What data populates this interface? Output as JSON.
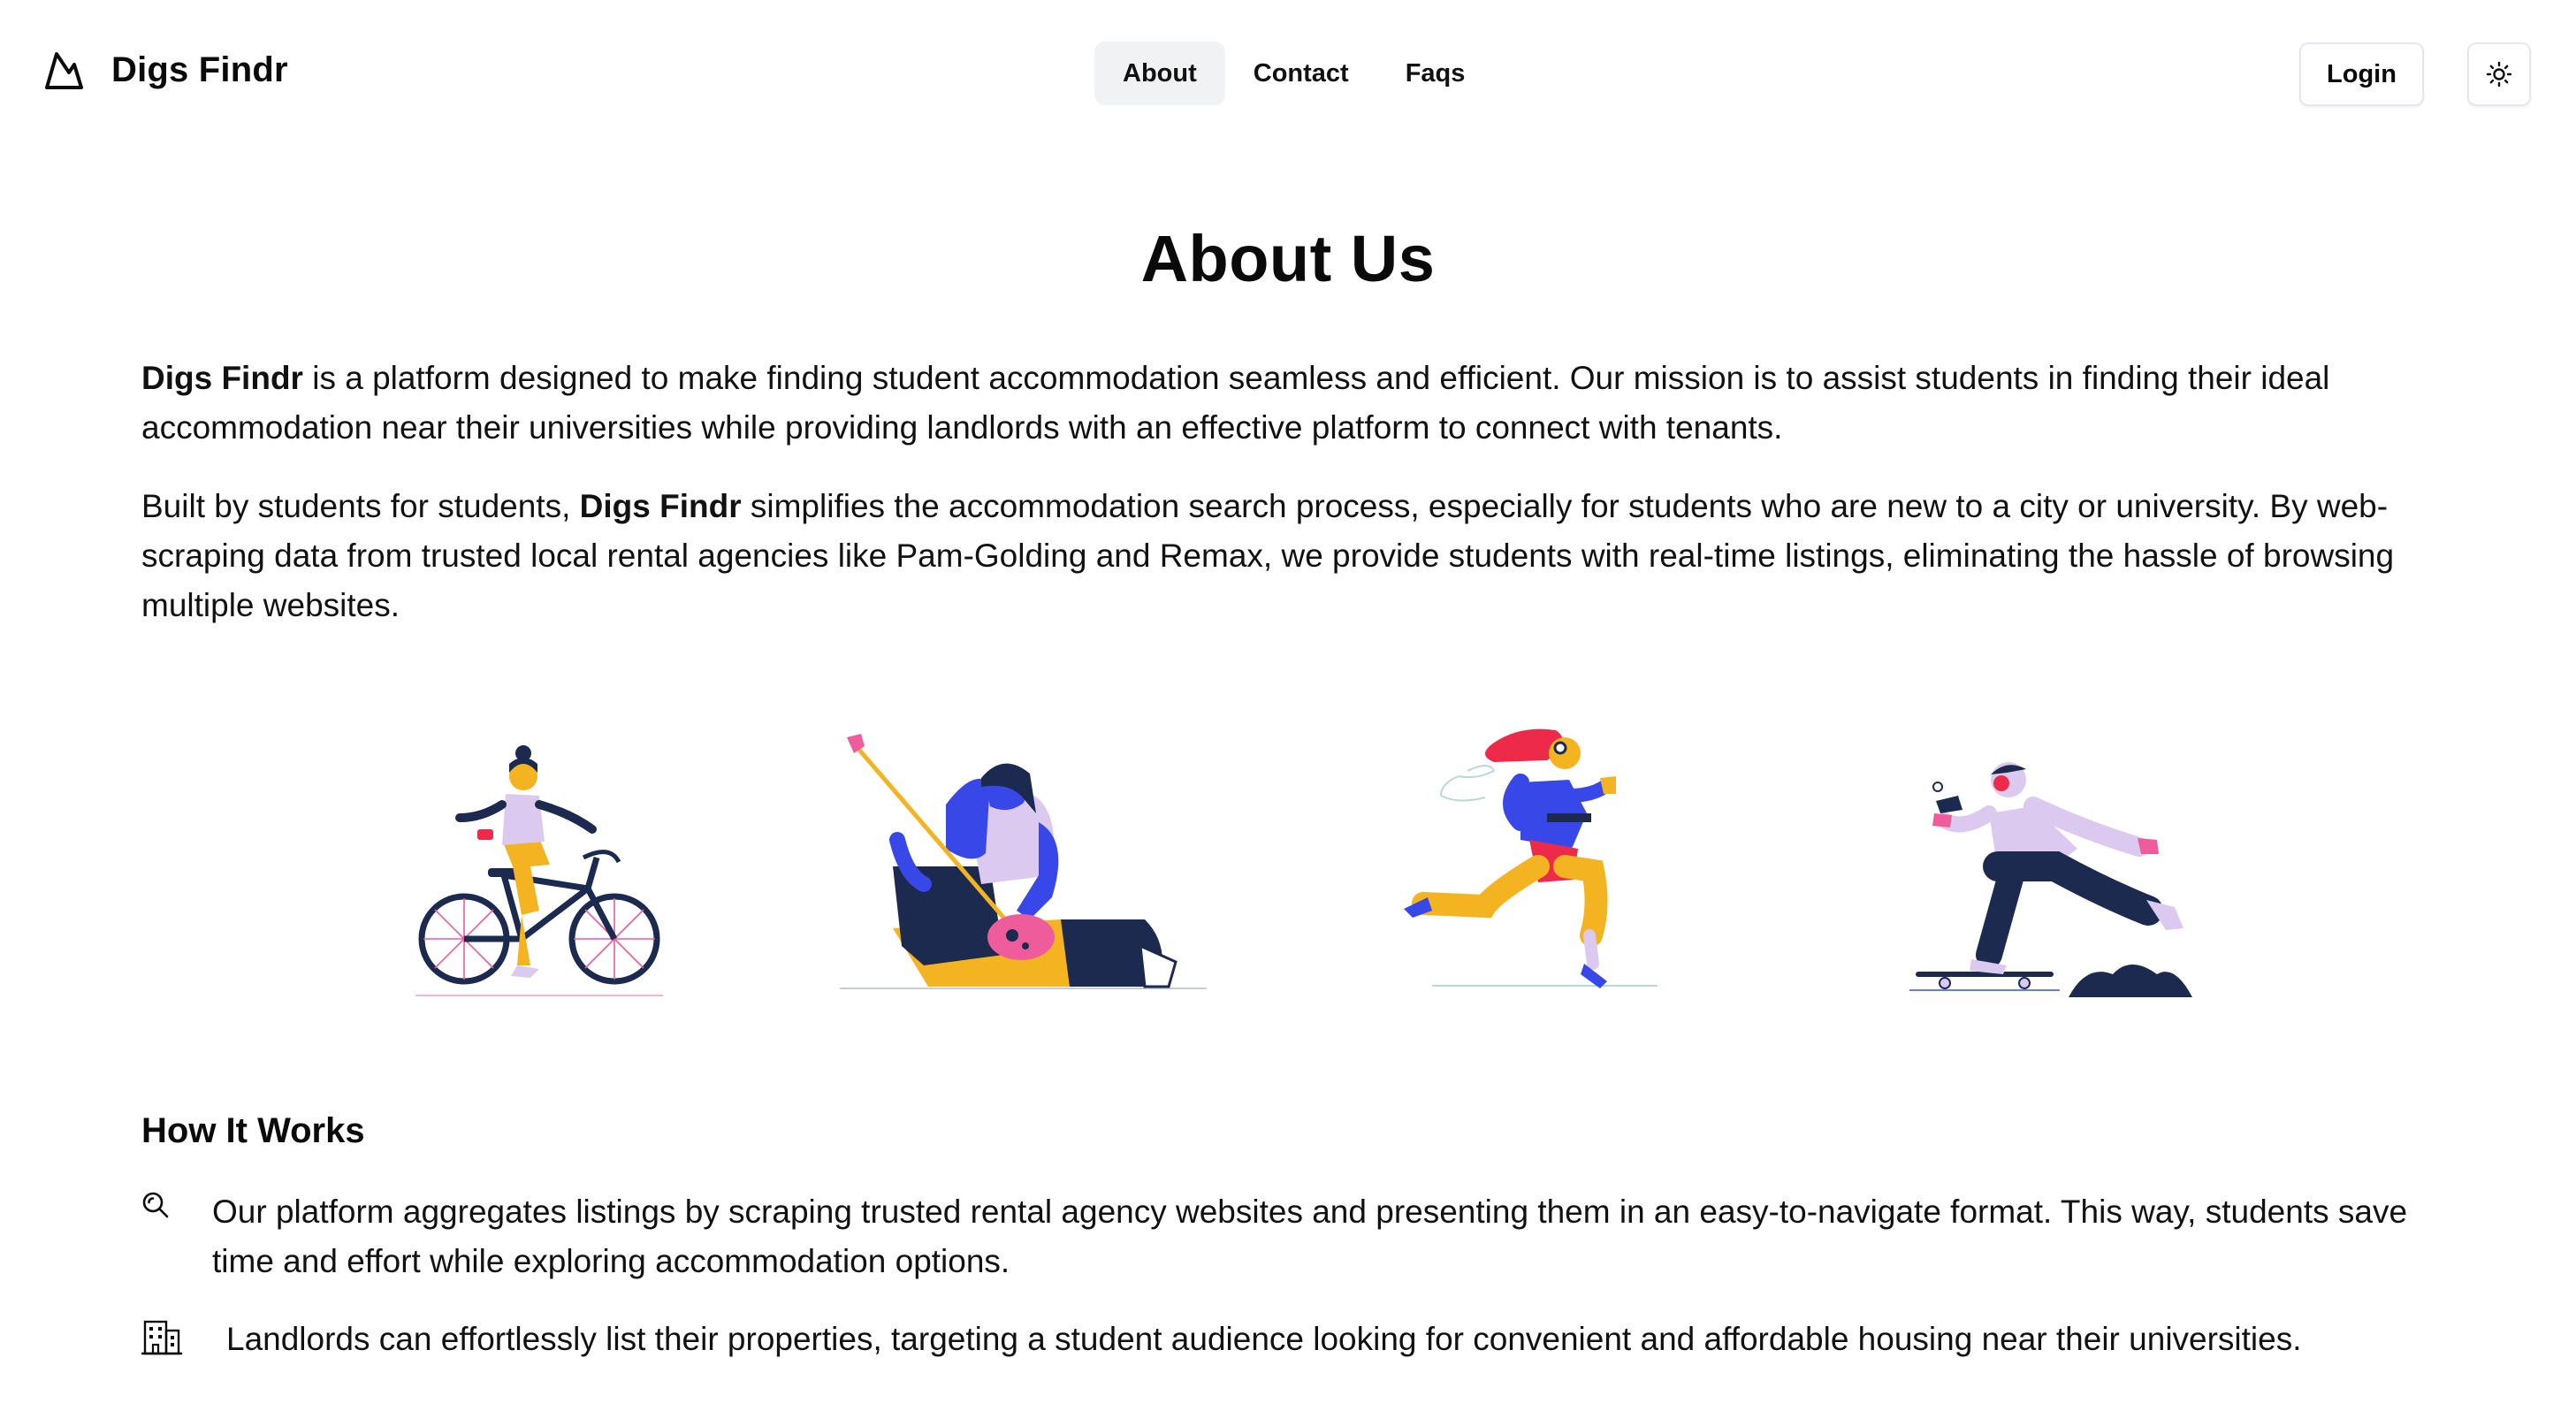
{
  "brand": {
    "name": "Digs Findr",
    "logo_icon": "mountain-icon"
  },
  "nav": {
    "items": [
      {
        "label": "About",
        "active": true
      },
      {
        "label": "Contact",
        "active": false
      },
      {
        "label": "Faqs",
        "active": false
      }
    ],
    "login_label": "Login",
    "theme_icon": "sun-icon"
  },
  "about": {
    "title": "About Us",
    "para1": {
      "brand": "Digs Findr",
      "text": " is a platform designed to make finding student accommodation seamless and efficient. Our mission is to assist students in finding their ideal accommodation near their universities while providing landlords with an effective platform to connect with tenants."
    },
    "para2": {
      "prefix": "Built by students for students, ",
      "brand": "Digs Findr",
      "text": " simplifies the accommodation search process, especially for students who are new to a city or university. By web-scraping data from trusted local rental agencies like Pam-Golding and Remax, we provide students with real-time listings, eliminating the hassle of browsing multiple websites."
    }
  },
  "illustrations": [
    "cyclist-illustration",
    "guitarist-illustration",
    "runner-illustration",
    "skateboarder-illustration"
  ],
  "how_it_works": {
    "title": "How It Works",
    "features": [
      {
        "icon": "search-icon",
        "text": "Our platform aggregates listings by scraping trusted rental agency websites and presenting them in an easy-to-navigate format. This way, students save time and effort while exploring accommodation options."
      },
      {
        "icon": "building-icon",
        "text": "Landlords can effortlessly list their properties, targeting a student audience looking for convenient and affordable housing near their universities."
      }
    ]
  },
  "colors": {
    "text": "#0a0a0a",
    "nav_active_bg": "#f1f2f4",
    "border": "#e5e7eb",
    "illustration_navy": "#1b2a4e",
    "illustration_yellow": "#f4b321",
    "illustration_blue": "#3848e8",
    "illustration_lilac": "#dcc9ef",
    "illustration_red": "#ee2a4a",
    "illustration_pink": "#ee5c9c"
  }
}
